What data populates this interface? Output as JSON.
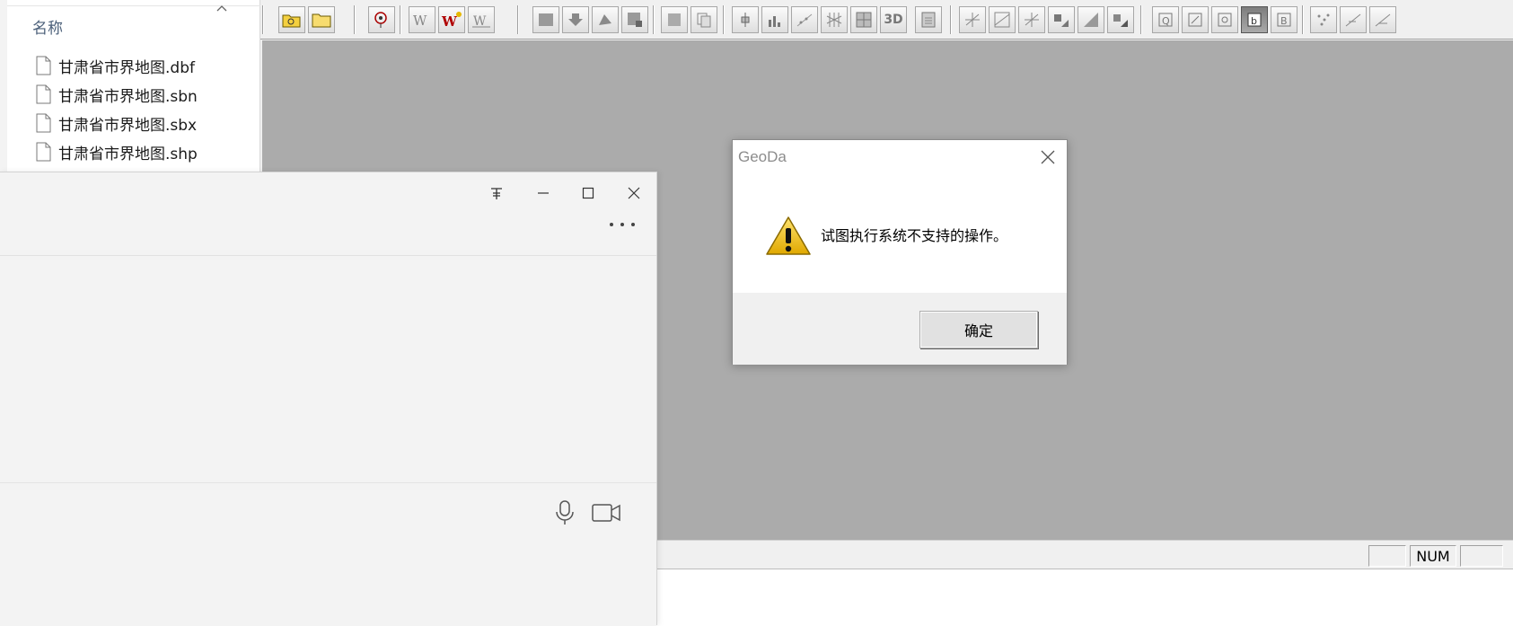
{
  "explorer": {
    "column_header": "名称",
    "files": [
      "甘肃省市界地图.dbf",
      "甘肃省市界地图.sbn",
      "甘肃省市界地图.sbx",
      "甘肃省市界地图.shp"
    ]
  },
  "toolbar": {
    "text_buttons": {
      "three_d": "3D"
    }
  },
  "statusbar": {
    "num_indicator": "NUM"
  },
  "dialog": {
    "title": "GeoDa",
    "message": "试图执行系统不支持的操作。",
    "ok_label": "确定",
    "icon": "warning-icon"
  },
  "chat_window": {
    "controls": [
      "pin-icon",
      "minimize-icon",
      "maximize-icon",
      "close-icon"
    ],
    "composer_icons": [
      "microphone-icon",
      "video-camera-icon"
    ]
  },
  "colors": {
    "workspace_gray": "#ababab",
    "warning_yellow": "#f5c518",
    "explorer_header": "#4c607a"
  }
}
